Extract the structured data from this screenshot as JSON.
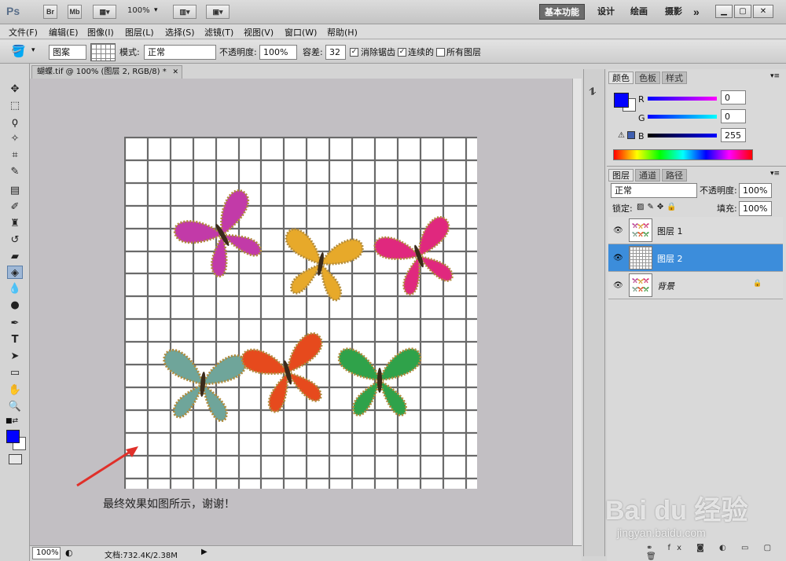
{
  "titlebar": {
    "ps": "Ps",
    "br": "Br",
    "mb": "Mb",
    "zoom": "100%",
    "workspaces": [
      "基本功能",
      "设计",
      "绘画",
      "摄影"
    ],
    "more": "»"
  },
  "menu": [
    "文件(F)",
    "编辑(E)",
    "图像(I)",
    "图层(L)",
    "选择(S)",
    "滤镜(T)",
    "视图(V)",
    "窗口(W)",
    "帮助(H)"
  ],
  "options": {
    "fill_source": "图案",
    "mode_label": "模式:",
    "mode": "正常",
    "opacity_label": "不透明度:",
    "opacity": "100%",
    "tolerance_label": "容差:",
    "tolerance": "32",
    "antialias": "消除锯齿",
    "contiguous": "连续的",
    "all_layers": "所有图层"
  },
  "document": {
    "tab_title": "蝴蝶.tif @ 100% (图层 2, RGB/8) *",
    "annotation": "最终效果如图所示，谢谢！"
  },
  "status": {
    "zoom": "100%",
    "doc_info": "文档:732.4K/2.38M"
  },
  "color_panel": {
    "tabs": [
      "颜色",
      "色板",
      "样式"
    ],
    "r_label": "R",
    "g_label": "G",
    "b_label": "B",
    "r": "0",
    "g": "0",
    "b": "255",
    "foreground": "#0000ff"
  },
  "layers_panel": {
    "tabs": [
      "图层",
      "通道",
      "路径"
    ],
    "blend": "正常",
    "opacity_label": "不透明度:",
    "opacity": "100%",
    "lock_label": "锁定:",
    "fill_label": "填充:",
    "fill": "100%",
    "layers": [
      {
        "name": "图层 1"
      },
      {
        "name": "图层 2"
      },
      {
        "name": "背景"
      }
    ]
  },
  "butterfly_colors": [
    "#c23aa8",
    "#e7a92a",
    "#e0287e",
    "#6fa59a",
    "#e64a1d",
    "#2fa24a"
  ],
  "watermark": {
    "text": "Bai du 经验",
    "url": "jingyan.baidu.com"
  }
}
